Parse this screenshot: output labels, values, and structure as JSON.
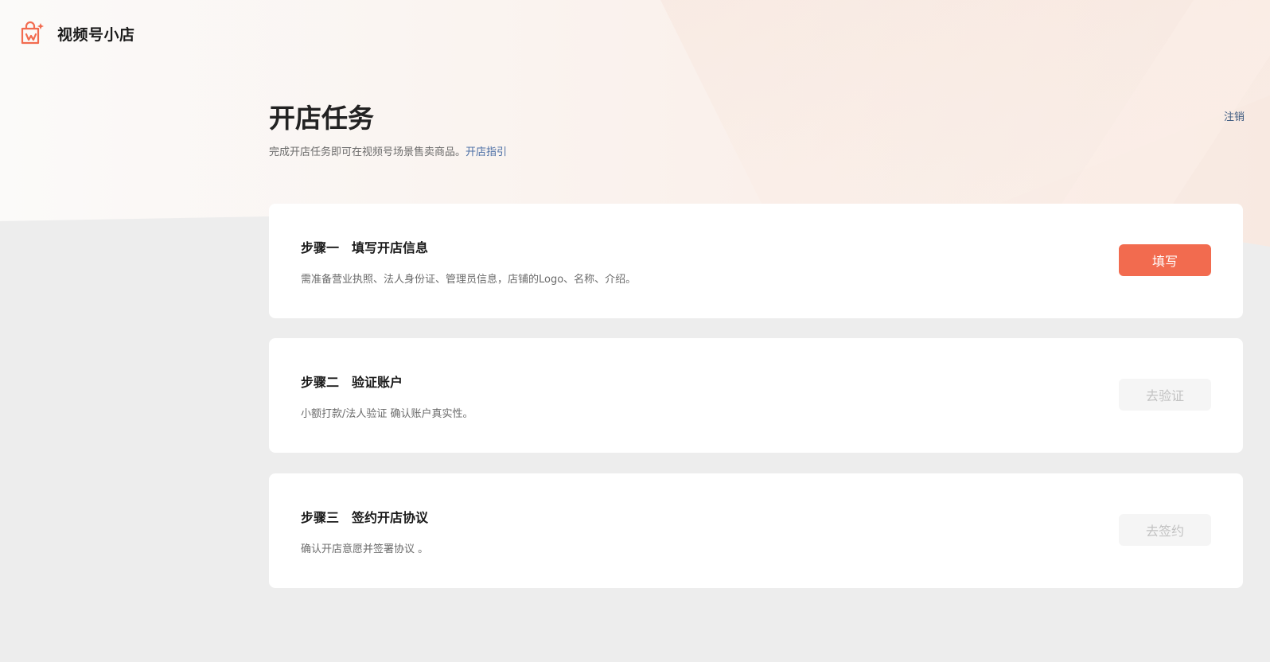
{
  "app": {
    "name": "视频号小店",
    "logo_icon": "shopping-bag-icon",
    "accent_color": "#f26b4f",
    "link_color": "#4a6ea5"
  },
  "header": {
    "title": "开店任务",
    "subtitle": "完成开店任务即可在视频号场景售卖商品。",
    "guide_link": "开店指引",
    "logout": "注销"
  },
  "steps": [
    {
      "title": "步骤一　填写开店信息",
      "description": "需准备营业执照、法人身份证、管理员信息，店铺的Logo、名称、介绍。",
      "button": "填写",
      "button_state": "active"
    },
    {
      "title": "步骤二　验证账户",
      "description": "小额打款/法人验证 确认账户真实性。",
      "button": "去验证",
      "button_state": "disabled"
    },
    {
      "title": "步骤三　签约开店协议",
      "description": "确认开店意愿并签署协议 。",
      "button": "去签约",
      "button_state": "disabled"
    }
  ]
}
